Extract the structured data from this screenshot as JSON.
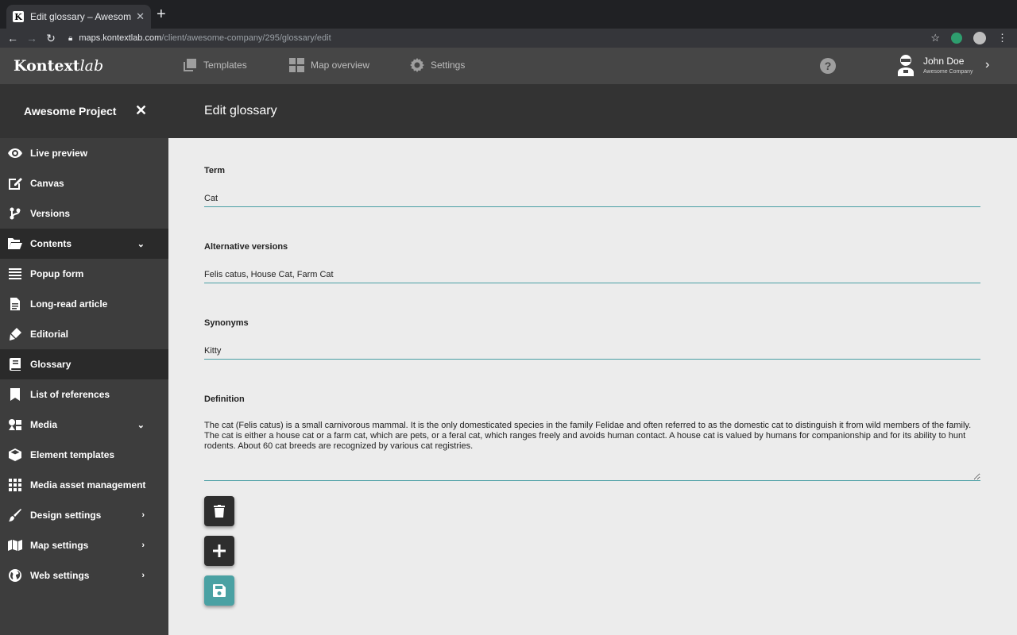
{
  "browser": {
    "tab_title": "Edit glossary – Awesome Projec",
    "favicon_letter": "K",
    "url_host": "maps.kontextlab.com",
    "url_path": "/client/awesome-company/295/glossary/edit"
  },
  "app": {
    "logo_bold": "Kontext",
    "logo_italic": "lab",
    "topnav": {
      "templates": "Templates",
      "map_overview": "Map overview",
      "settings": "Settings"
    },
    "user": {
      "name": "John Doe",
      "company": "Awesome Company"
    }
  },
  "subheader": {
    "project_title": "Awesome Project",
    "page_title": "Edit glossary"
  },
  "sidebar": {
    "items": [
      {
        "label": "Live preview",
        "icon": "eye-icon"
      },
      {
        "label": "Canvas",
        "icon": "edit-icon"
      },
      {
        "label": "Versions",
        "icon": "branch-icon"
      },
      {
        "label": "Contents",
        "icon": "folder-open-icon",
        "expandable": "down"
      },
      {
        "label": "Popup form",
        "icon": "lines-icon"
      },
      {
        "label": "Long-read article",
        "icon": "document-icon"
      },
      {
        "label": "Editorial",
        "icon": "pen-icon"
      },
      {
        "label": "Glossary",
        "icon": "book-icon"
      },
      {
        "label": "List of references",
        "icon": "bookmark-icon"
      },
      {
        "label": "Media",
        "icon": "media-icon",
        "expandable": "down"
      },
      {
        "label": "Element templates",
        "icon": "cube-icon"
      },
      {
        "label": "Media asset management",
        "icon": "grid-icon"
      },
      {
        "label": "Design settings",
        "icon": "brush-icon",
        "expandable": "right"
      },
      {
        "label": "Map settings",
        "icon": "map-icon",
        "expandable": "right"
      },
      {
        "label": "Web settings",
        "icon": "globe-icon",
        "expandable": "right"
      }
    ]
  },
  "form": {
    "term_label": "Term",
    "term_value": "Cat",
    "alt_label": "Alternative versions",
    "alt_value": "Felis catus, House Cat, Farm Cat",
    "syn_label": "Synonyms",
    "syn_value": "Kitty",
    "def_label": "Definition",
    "def_value": "The cat (Felis catus) is a small carnivorous mammal. It is the only domesticated species in the family Felidae and often referred to as the domestic cat to distinguish it from wild members of the family. The cat is either a house cat or a farm cat, which are pets, or a feral cat, which ranges freely and avoids human contact. A house cat is valued by humans for companionship and for its ability to hunt rodents. About 60 cat breeds are recognized by various cat registries."
  },
  "colors": {
    "accent": "#4aa1a3",
    "header": "#464646",
    "sidebar": "#3d3d3d",
    "sidebar_active": "#2a2a2a"
  }
}
